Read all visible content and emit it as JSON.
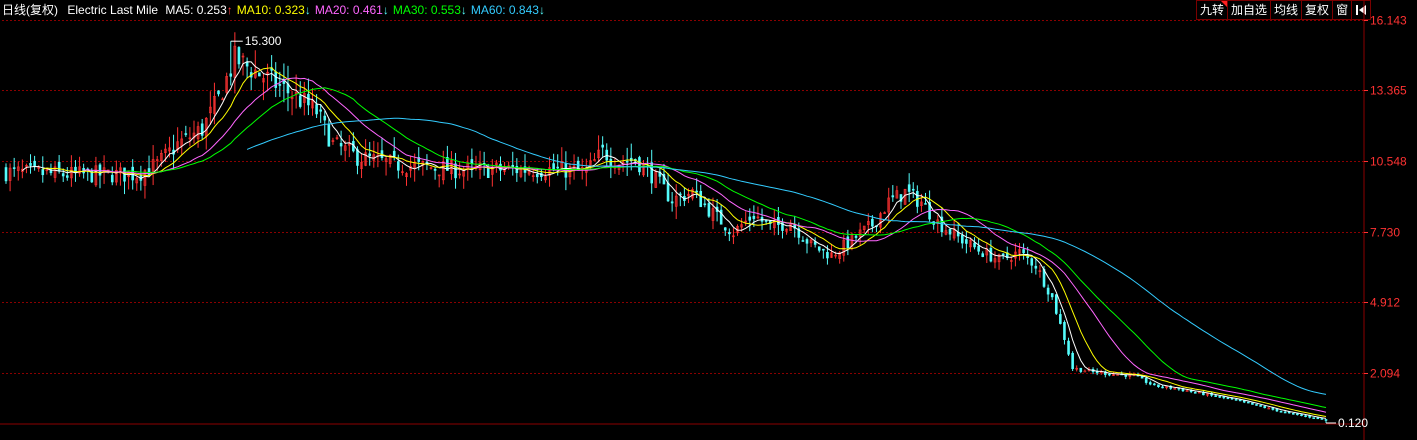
{
  "header": {
    "period": "日线(复权)",
    "name": "Electric Last Mile",
    "ma": [
      {
        "label": "MA5: ",
        "value": "0.253",
        "arrow": "↑",
        "color": "#ffffff"
      },
      {
        "label": "MA10: ",
        "value": "0.323",
        "arrow": "↓",
        "color": "#ffff00"
      },
      {
        "label": "MA20: ",
        "value": "0.461",
        "arrow": "↓",
        "color": "#ff66ff"
      },
      {
        "label": "MA30: ",
        "value": "0.553",
        "arrow": "↓",
        "color": "#00ff00"
      },
      {
        "label": "MA60: ",
        "value": "0.843",
        "arrow": "↓",
        "color": "#33ccff"
      }
    ]
  },
  "toolbar": {
    "buttons": [
      "九转",
      "加自选",
      "均线",
      "复权",
      "窗"
    ],
    "back_icon": "back-arrow-icon"
  },
  "colors": {
    "background": "#000000",
    "up": "#ff3232",
    "down": "#54fcfc",
    "grid": "#8b0000",
    "axis_text": "#ff3232",
    "arrow_up": "#ff4040",
    "arrow_down": "#54fcfc"
  },
  "chart_data": {
    "type": "candlestick",
    "ylim": [
      0.12,
      16.143
    ],
    "y_ticks": [
      "16.143",
      "13.365",
      "10.548",
      "7.730",
      "4.912",
      "2.094"
    ],
    "y_tick_values": [
      16.143,
      13.365,
      10.548,
      7.73,
      4.912,
      2.094
    ],
    "annotations": {
      "high": {
        "label": "15.300",
        "value": 15.3
      },
      "low": {
        "label": "0.120",
        "value": 0.12
      }
    },
    "close_keypoints": [
      [
        0,
        10.1
      ],
      [
        15,
        10.0
      ],
      [
        32,
        10.0
      ],
      [
        37,
        10.4
      ],
      [
        42,
        11.2
      ],
      [
        48,
        11.8
      ],
      [
        52,
        13.0
      ],
      [
        56,
        14.6
      ],
      [
        60,
        14.2
      ],
      [
        64,
        13.8
      ],
      [
        70,
        13.2
      ],
      [
        76,
        12.5
      ],
      [
        80,
        11.2
      ],
      [
        86,
        10.7
      ],
      [
        95,
        10.4
      ],
      [
        110,
        10.2
      ],
      [
        135,
        10.2
      ],
      [
        142,
        10.1
      ],
      [
        146,
        10.9
      ],
      [
        150,
        10.5
      ],
      [
        154,
        10.6
      ],
      [
        158,
        10.0
      ],
      [
        163,
        9.0
      ],
      [
        168,
        9.3
      ],
      [
        172,
        8.6
      ],
      [
        178,
        7.7
      ],
      [
        183,
        8.4
      ],
      [
        187,
        7.9
      ],
      [
        192,
        8.1
      ],
      [
        197,
        7.2
      ],
      [
        202,
        6.8
      ],
      [
        207,
        7.4
      ],
      [
        212,
        8.0
      ],
      [
        216,
        8.9
      ],
      [
        220,
        9.3
      ],
      [
        224,
        8.9
      ],
      [
        228,
        8.1
      ],
      [
        233,
        7.5
      ],
      [
        238,
        7.0
      ],
      [
        243,
        6.6
      ],
      [
        248,
        6.9
      ],
      [
        252,
        6.4
      ],
      [
        256,
        5.1
      ],
      [
        259,
        3.5
      ],
      [
        261,
        2.3
      ],
      [
        266,
        2.15
      ],
      [
        276,
        2.0
      ],
      [
        281,
        1.6
      ],
      [
        286,
        1.5
      ],
      [
        300,
        1.05
      ],
      [
        314,
        0.5
      ],
      [
        323,
        0.25
      ]
    ]
  }
}
